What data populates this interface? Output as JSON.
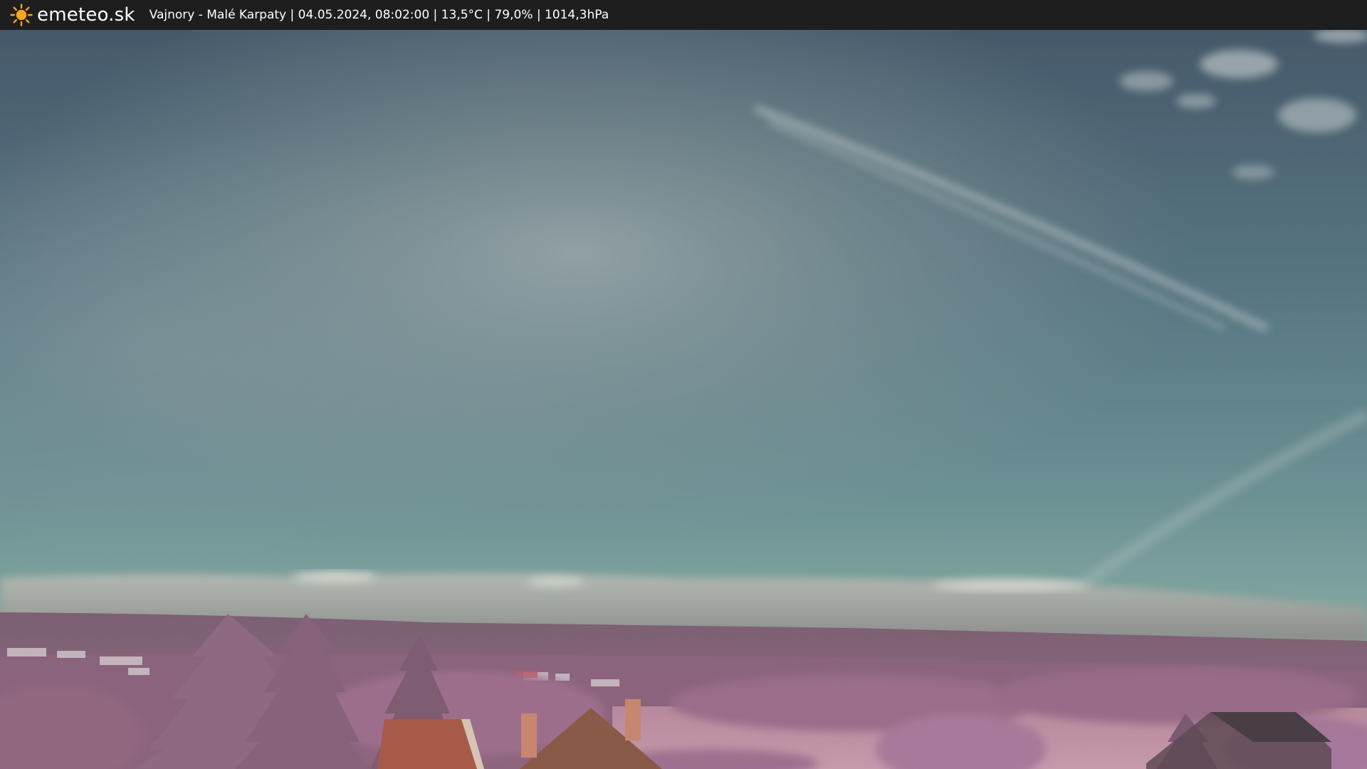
{
  "header": {
    "brand": "emeteo.sk",
    "brand_icon": "sun-icon",
    "caption": "Vajnory - Malé Karpaty | 04.05.2024, 08:02:00 | 13,5°C | 79,0% | 1014,3hPa"
  },
  "colors": {
    "bar": "#1e1e1e",
    "sun": "#f5a623",
    "sky_top": "#4a5c6c",
    "sky_mid": "#5d8088",
    "sky_horizon": "#7fa39c",
    "hills": "#8a607a",
    "foliage": "#9c6e8e",
    "roof": "#a85a48"
  }
}
